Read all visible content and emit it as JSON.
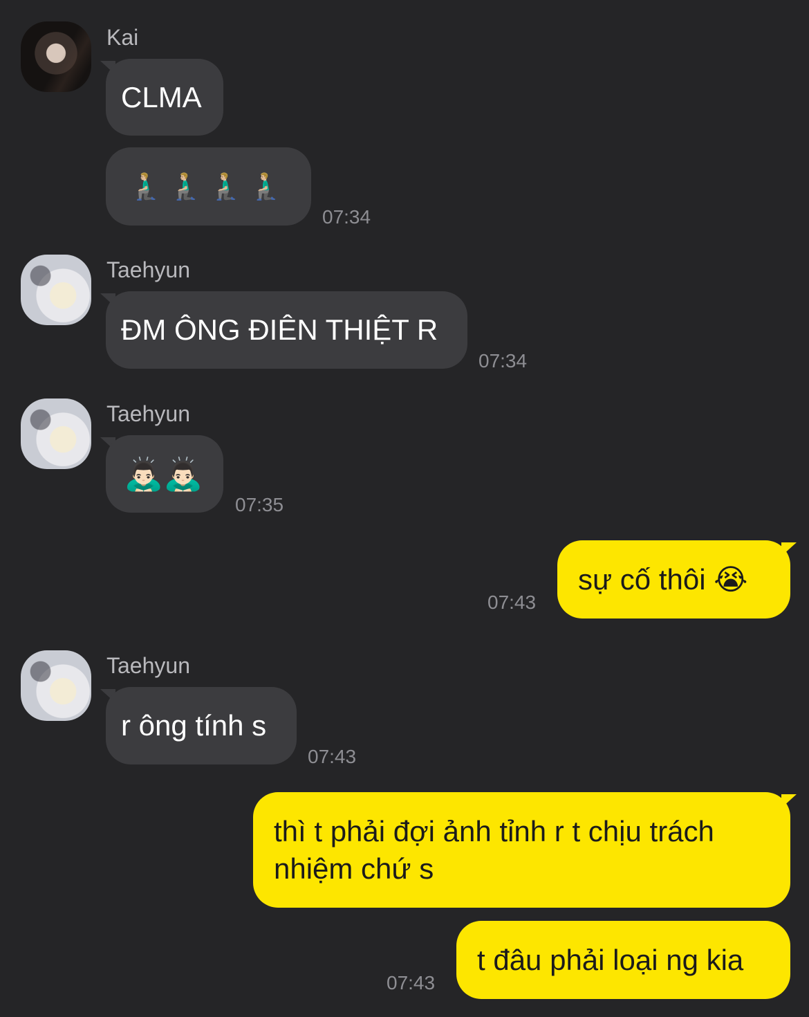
{
  "messages": [
    {
      "sender": "Kai",
      "text": "CLMA"
    },
    {
      "sender": "Kai",
      "text": "🧎🏼‍♂️ 🧎🏼‍♂️ 🧎🏼‍♂️ 🧎🏼‍♂️",
      "time": "07:34"
    },
    {
      "sender": "Taehyun",
      "text": "ĐM ÔNG ĐIÊN THIỆT R",
      "time": "07:34"
    },
    {
      "sender": "Taehyun",
      "text": "🙇🏻‍♂️🙇🏻‍♂️",
      "time": "07:35"
    },
    {
      "sender": "me",
      "text": "sự cố thôi 😭",
      "time": "07:43"
    },
    {
      "sender": "Taehyun",
      "text": "r ông tính s",
      "time": "07:43"
    },
    {
      "sender": "me",
      "text": "thì t phải đợi ảnh tỉnh r t chịu trách nhiệm chứ s"
    },
    {
      "sender": "me",
      "text": "t đâu phải loại ng kia",
      "time": "07:43"
    }
  ],
  "colors": {
    "background": "#252527",
    "incoming_bubble": "#3c3c3f",
    "outgoing_bubble": "#fde600",
    "timestamp": "#8e8e93"
  }
}
